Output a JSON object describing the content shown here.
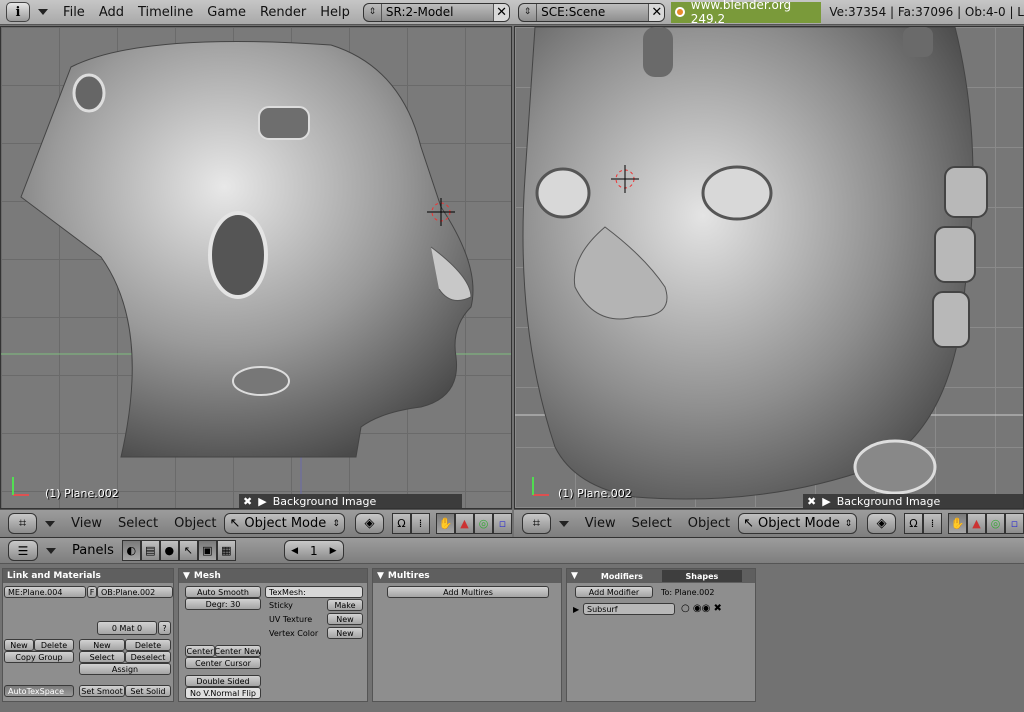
{
  "topbar": {
    "menus": [
      "File",
      "Add",
      "Timeline",
      "Game",
      "Render",
      "Help"
    ],
    "screen": "SR:2-Model",
    "scene": "SCE:Scene",
    "url": "www.blender.org 249.2",
    "stats": "Ve:37354 | Fa:37096 | Ob:4-0 | L"
  },
  "left_view": {
    "object_label": "(1) Plane.002",
    "bg_image": "Background Image",
    "menus": [
      "View",
      "Select",
      "Object"
    ],
    "mode": "Object Mode"
  },
  "right_view": {
    "object_label": "(1) Plane.002",
    "bg_image": "Background Image",
    "menus": [
      "View",
      "Select",
      "Object"
    ],
    "mode": "Object Mode"
  },
  "buttons_header": {
    "panels_label": "Panels",
    "frame": "1"
  },
  "link_materials": {
    "title": "Link and Materials",
    "mesh_name": "ME:Plane.004",
    "f_label": "F",
    "ob_name": "OB:Plane.002",
    "mat_counter": "0 Mat 0",
    "question": "?",
    "new": "New",
    "delete": "Delete",
    "copy_group": "Copy Group",
    "new2": "New",
    "delete2": "Delete",
    "select": "Select",
    "deselect": "Deselect",
    "assign": "Assign",
    "autotexspace": "AutoTexSpace",
    "set_smooth": "Set Smoot",
    "set_solid": "Set Solid"
  },
  "mesh": {
    "title": "Mesh",
    "auto_smooth": "Auto Smooth",
    "degr": "Degr: 30",
    "texmesh": "TexMesh:",
    "sticky": "Sticky",
    "make": "Make",
    "uv_texture": "UV Texture",
    "uv_new": "New",
    "vertex_color": "Vertex Color",
    "vc_new": "New",
    "center": "Center",
    "center_new": "Center New",
    "center_cursor": "Center Cursor",
    "double_sided": "Double Sided",
    "no_vnormal_flip": "No V.Normal Flip"
  },
  "multires": {
    "title": "Multires",
    "add": "Add Multires"
  },
  "modifiers": {
    "tab_modifiers": "Modifiers",
    "tab_shapes": "Shapes",
    "add_modifier": "Add Modifier",
    "to_label": "To: Plane.002",
    "subsurf": "Subsurf"
  }
}
